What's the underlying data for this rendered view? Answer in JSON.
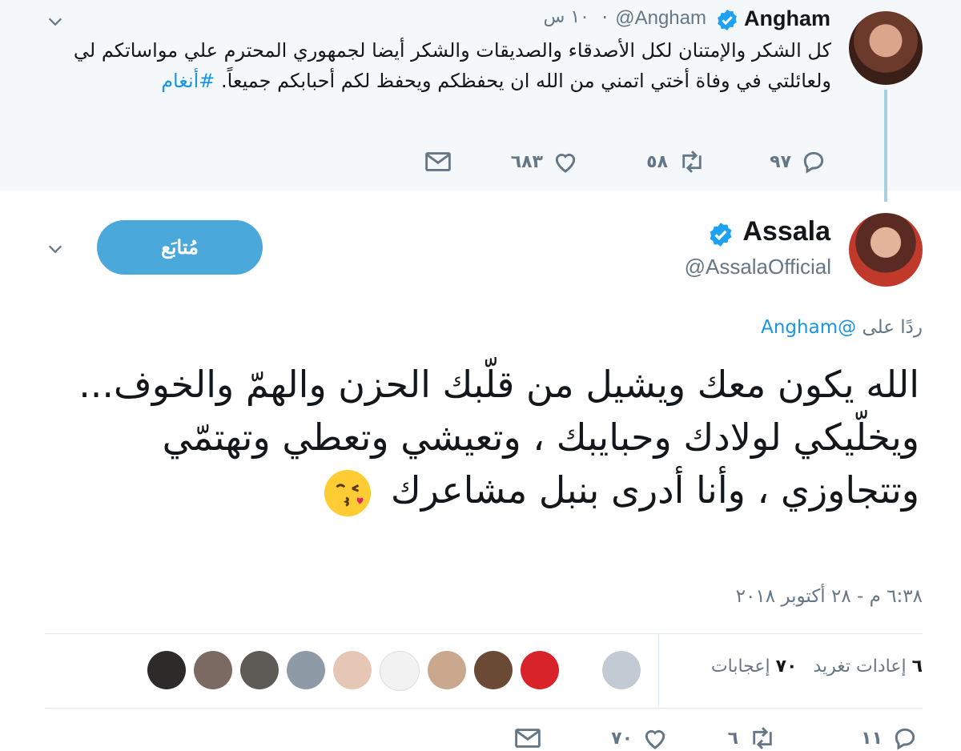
{
  "parent_tweet": {
    "display_name": "Angham",
    "handle": "@Angham",
    "time": "١٠ س",
    "text": "كل الشكر والإمتنان لكل الأصدقاء والصديقات والشكر أيضا لجمهوري المحترم علي مواساتكم لي ولعائلتي في وفاة أختي اتمني من الله ان يحفظكم ويحفظ لكم أحبابكم جميعاً.",
    "hashtag": "#أنغام",
    "replies": "٩٧",
    "retweets": "٥٨",
    "likes": "٦٨٣"
  },
  "main_tweet": {
    "display_name": "Assala",
    "handle": "@AssalaOfficial",
    "follow_label": "مُتابَع",
    "reply_prefix": "ردًا على",
    "reply_mention": "@Angham",
    "text": "الله يكون معك ويشيل من قلّبك الحزن والهمّ والخوف... ويخلّيكي لولادك وحبايبك ، وتعيشي وتعطي وتهتمّي وتتجاوزي ، وأنا أدرى بنبل مشاعرك",
    "timestamp": "٦:٣٨ م - ٢٨ أكتوبر ٢٠١٨",
    "retweets_count": "٦",
    "retweets_label": "إعادات تغريد",
    "likes_count": "٧٠",
    "likes_label": "إعجابات",
    "footer_replies": "١١",
    "footer_retweets": "٦",
    "footer_likes": "٧٠"
  },
  "icons": {
    "verified": "verified-badge-icon",
    "reply": "reply-icon",
    "retweet": "retweet-icon",
    "like": "heart-icon",
    "dm": "envelope-icon",
    "more": "chevron-down-icon"
  },
  "colors": {
    "link": "#1b95e0",
    "follow_button": "#4aa8db",
    "muted": "#657786",
    "thread_line": "#a9d0df"
  }
}
